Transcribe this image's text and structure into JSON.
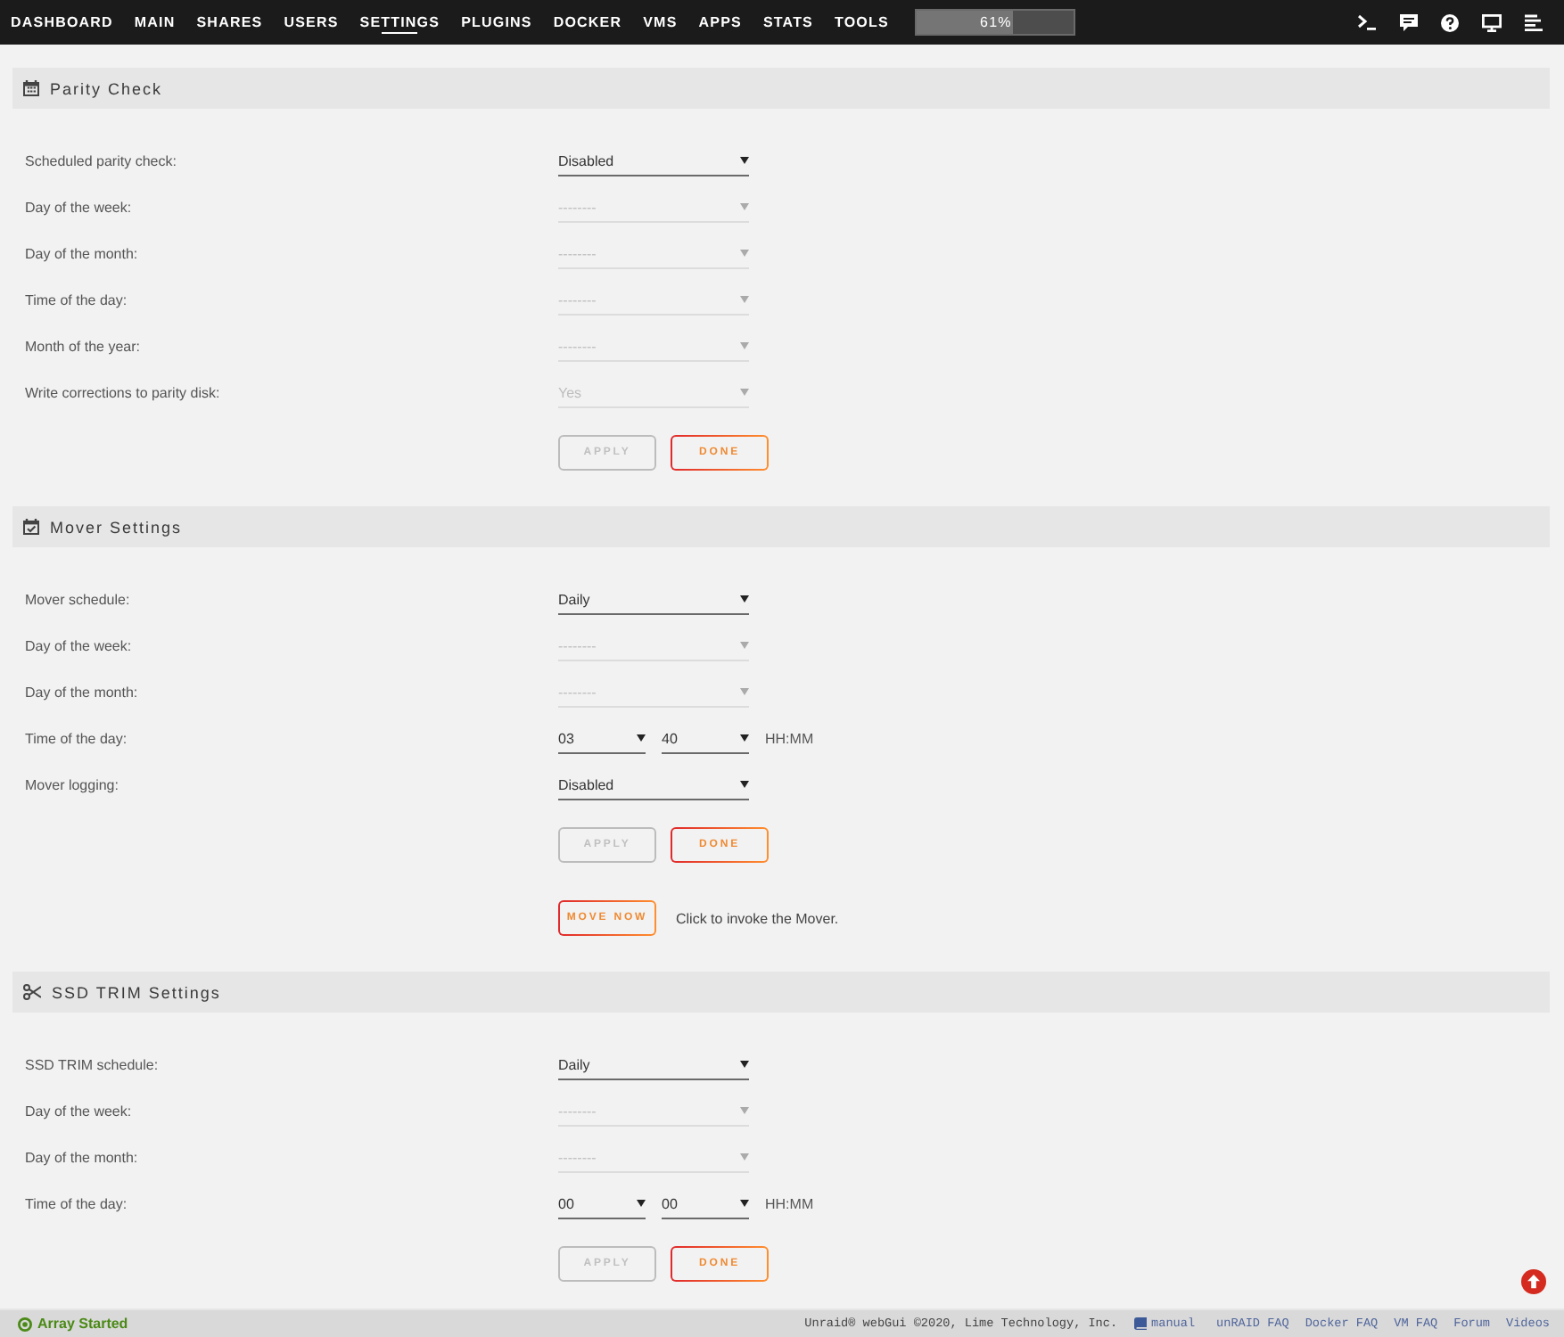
{
  "nav": {
    "tabs": [
      {
        "label": "DASHBOARD",
        "selected": false
      },
      {
        "label": "MAIN",
        "selected": false
      },
      {
        "label": "SHARES",
        "selected": false
      },
      {
        "label": "USERS",
        "selected": false
      },
      {
        "label": "SETTINGS",
        "selected": true
      },
      {
        "label": "PLUGINS",
        "selected": false
      },
      {
        "label": "DOCKER",
        "selected": false
      },
      {
        "label": "VMS",
        "selected": false
      },
      {
        "label": "APPS",
        "selected": false
      },
      {
        "label": "STATS",
        "selected": false
      },
      {
        "label": "TOOLS",
        "selected": false
      }
    ],
    "progress": {
      "text": "61%",
      "level": 0.61
    }
  },
  "sections": [
    {
      "title": "Parity Check",
      "rows": [
        {
          "kind": "select",
          "label": "Scheduled parity check:",
          "value": "Disabled",
          "disabled": false
        },
        {
          "kind": "select",
          "label": "Day of the week:",
          "value": "--------",
          "disabled": true
        },
        {
          "kind": "select",
          "label": "Day of the month:",
          "value": "--------",
          "disabled": true
        },
        {
          "kind": "select",
          "label": "Time of the day:",
          "value": "--------",
          "disabled": true
        },
        {
          "kind": "select",
          "label": "Month of the year:",
          "value": "--------",
          "disabled": true
        },
        {
          "kind": "select",
          "label": "Write corrections to parity disk:",
          "value": "Yes",
          "disabled": true
        }
      ],
      "buttons": [
        {
          "label": "APPLY",
          "disabled": true
        },
        {
          "label": "DONE",
          "disabled": false
        }
      ]
    },
    {
      "title": "Mover Settings",
      "rows": [
        {
          "kind": "select",
          "label": "Mover schedule:",
          "value": "Daily",
          "disabled": false
        },
        {
          "kind": "select",
          "label": "Day of the week:",
          "value": "--------",
          "disabled": true
        },
        {
          "kind": "select",
          "label": "Day of the month:",
          "value": "--------",
          "disabled": true
        },
        {
          "kind": "time",
          "label": "Time of the day:",
          "fields": [
            {
              "value": "03",
              "disabled": false
            },
            {
              "value": "40",
              "disabled": false
            }
          ],
          "unit": "HH:MM"
        },
        {
          "kind": "select",
          "label": "Mover logging:",
          "value": "Disabled",
          "disabled": false
        }
      ],
      "buttons": [
        {
          "label": "APPLY",
          "disabled": true
        },
        {
          "label": "DONE",
          "disabled": false
        }
      ],
      "extra": {
        "button": {
          "label": "MOVE NOW",
          "disabled": false
        },
        "note": "Click to invoke the Mover."
      }
    },
    {
      "title": "SSD TRIM Settings",
      "rows": [
        {
          "kind": "select",
          "label": "SSD TRIM schedule:",
          "value": "Daily",
          "disabled": false
        },
        {
          "kind": "select",
          "label": "Day of the week:",
          "value": "--------",
          "disabled": true
        },
        {
          "kind": "select",
          "label": "Day of the month:",
          "value": "--------",
          "disabled": true
        },
        {
          "kind": "time",
          "label": "Time of the day:",
          "fields": [
            {
              "value": "00",
              "disabled": false
            },
            {
              "value": "00",
              "disabled": false
            }
          ],
          "unit": "HH:MM"
        }
      ],
      "buttons": [
        {
          "label": "APPLY",
          "disabled": true
        },
        {
          "label": "DONE",
          "disabled": false
        }
      ]
    }
  ],
  "footer": {
    "status": "Array Started",
    "copyright": "Unraid® webGui ©2020, Lime Technology, Inc.",
    "manual": "manual",
    "links": [
      "unRAID FAQ",
      "Docker FAQ",
      "VM FAQ",
      "Forum",
      "Videos"
    ]
  }
}
